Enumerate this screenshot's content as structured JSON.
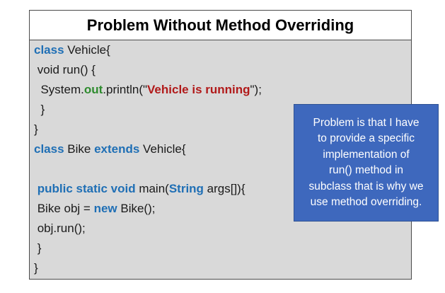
{
  "title": "Problem Without Method Overriding",
  "code": {
    "line1": {
      "kw": "class",
      "rest": " Vehicle{"
    },
    "line2": {
      "text": " void run() {"
    },
    "line3": {
      "pre": "  System.",
      "field": "out",
      "mid": ".println(\"",
      "str": "Vehicle is running",
      "post": "\");"
    },
    "line4": {
      "text": "  }"
    },
    "line5": {
      "text": "}"
    },
    "line6": {
      "kw1": "class",
      "mid": " Bike ",
      "kw2": "extends",
      "rest": " Vehicle{"
    },
    "line7": {
      "text": ""
    },
    "line8": {
      "pre": " ",
      "kw1": "public static void",
      "mid": " main(",
      "kw2": "String",
      "rest": " args[]){"
    },
    "line9": {
      "pre": " Bike obj = ",
      "kw": "new",
      "rest": " Bike();"
    },
    "line10": {
      "text": " obj.run();"
    },
    "line11": {
      "text": " }"
    },
    "line12": {
      "text": "}"
    }
  },
  "callout": {
    "line1": "Problem is that I have",
    "line2": "to provide a specific",
    "line3": "implementation of",
    "line4": "run() method in",
    "line5": "subclass that is why we",
    "line6": "use method overriding."
  },
  "colors": {
    "keyword": "#1f6fb5",
    "field": "#2e8b2e",
    "string": "#b11a1a",
    "callout_bg": "#3e68bd",
    "code_bg": "#d9d9d9"
  }
}
